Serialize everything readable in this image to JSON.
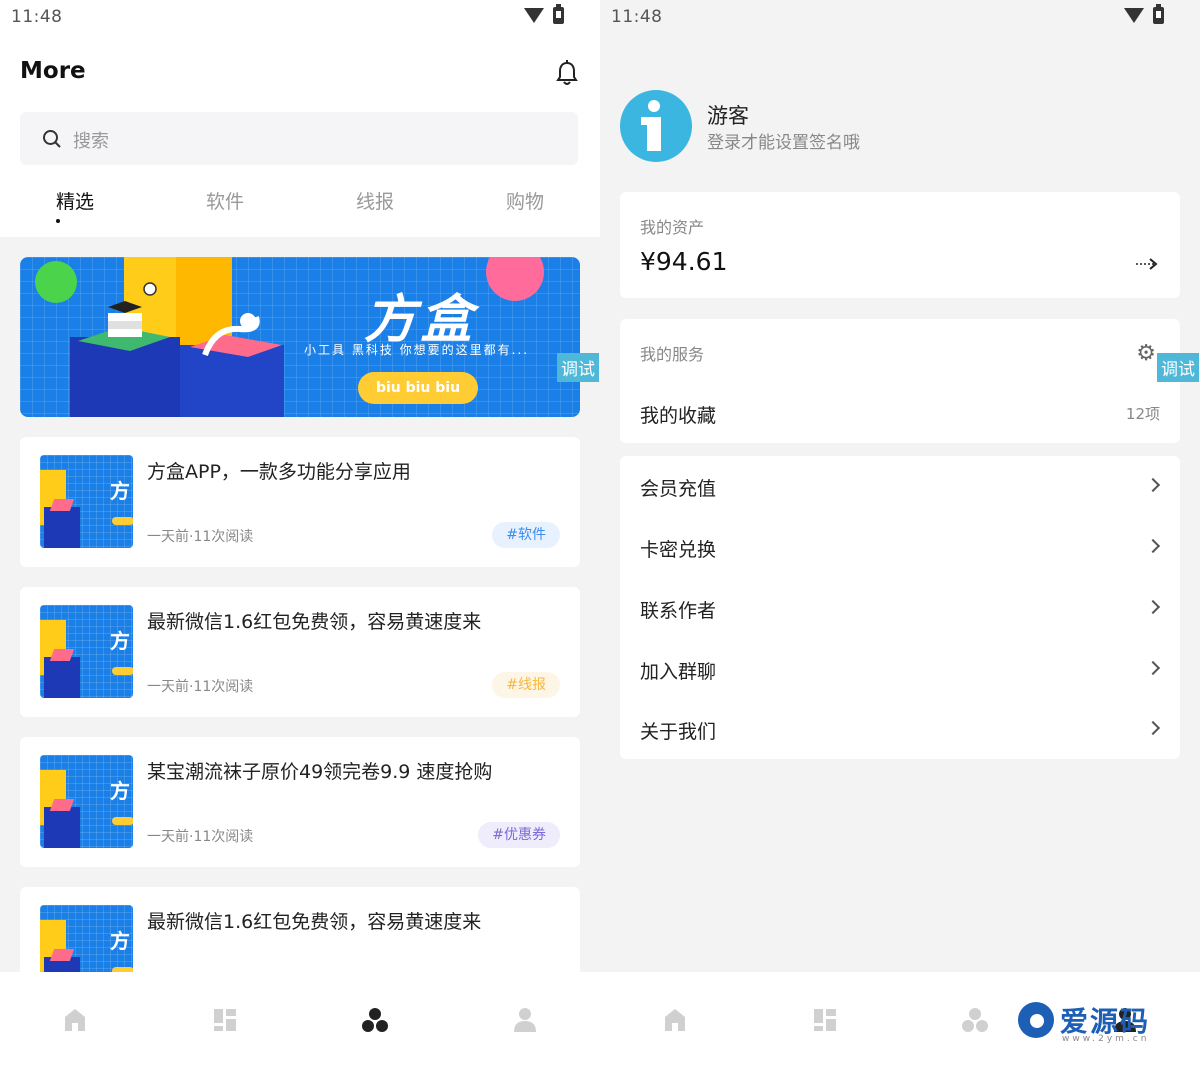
{
  "status": {
    "time": "11:48"
  },
  "left": {
    "title": "More",
    "search_placeholder": "搜索",
    "tabs": [
      "精选",
      "软件",
      "线报",
      "购物"
    ],
    "banner": {
      "title": "方盒",
      "subtitle": "小工具 黑科技 你想要的这里都有...",
      "button": "biu biu biu",
      "debug": "调试"
    },
    "articles": [
      {
        "title": "方盒APP，一款多功能分享应用",
        "meta": "一天前·11次阅读",
        "tag": "#软件",
        "tag_color": "#3d8cf0",
        "tag_bg": "#e8f1fe"
      },
      {
        "title": "最新微信1.6红包免费领，容易黄速度来",
        "meta": "一天前·11次阅读",
        "tag": "#线报",
        "tag_color": "#f5b93d",
        "tag_bg": "#fdf5e6"
      },
      {
        "title": "某宝潮流袜子原价49领完卷9.9 速度抢购",
        "meta": "一天前·11次阅读",
        "tag": "#优惠券",
        "tag_color": "#7b6ad6",
        "tag_bg": "#efecfb"
      },
      {
        "title": "最新微信1.6红包免费领，容易黄速度来",
        "meta": "",
        "tag": "",
        "tag_color": "#f5b93d",
        "tag_bg": "#fdf5e6"
      }
    ]
  },
  "right": {
    "user": {
      "name": "游客",
      "subtitle": "登录才能设置签名哦"
    },
    "assets": {
      "label": "我的资产",
      "amount": "¥94.61"
    },
    "services": {
      "label": "我的服务",
      "debug": "调试",
      "favorites_label": "我的收藏",
      "favorites_count": "12项"
    },
    "menu": [
      "会员充值",
      "卡密兑换",
      "联系作者",
      "加入群聊",
      "关于我们"
    ],
    "watermark": {
      "text": "爱源码",
      "url": "www.2ym.cn"
    }
  },
  "nav_icons": [
    "home-icon",
    "dashboard-icon",
    "discover-icon",
    "user-icon"
  ],
  "colors": {
    "accent": "#1a7fe6",
    "active_nav": "#222222",
    "inactive_nav": "#cccccc"
  }
}
